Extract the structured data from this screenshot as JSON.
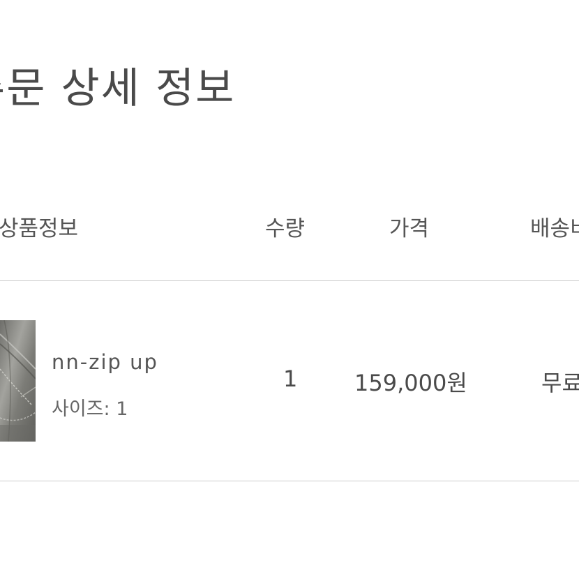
{
  "page": {
    "title": "주문 상세 정보"
  },
  "table": {
    "headers": {
      "product": "상품정보",
      "quantity": "수량",
      "price": "가격",
      "shipping": "배송비"
    },
    "rows": [
      {
        "name": "nn-zip up",
        "option": "사이즈: 1",
        "quantity": "1",
        "price": "159,000원",
        "shipping": "무료"
      }
    ]
  },
  "colors": {
    "text": "#4a4a4a",
    "divider": "#cccccc",
    "thumbnail": "#8a8a85"
  },
  "icons": {
    "product_image": "leather-jacket-thumbnail"
  }
}
